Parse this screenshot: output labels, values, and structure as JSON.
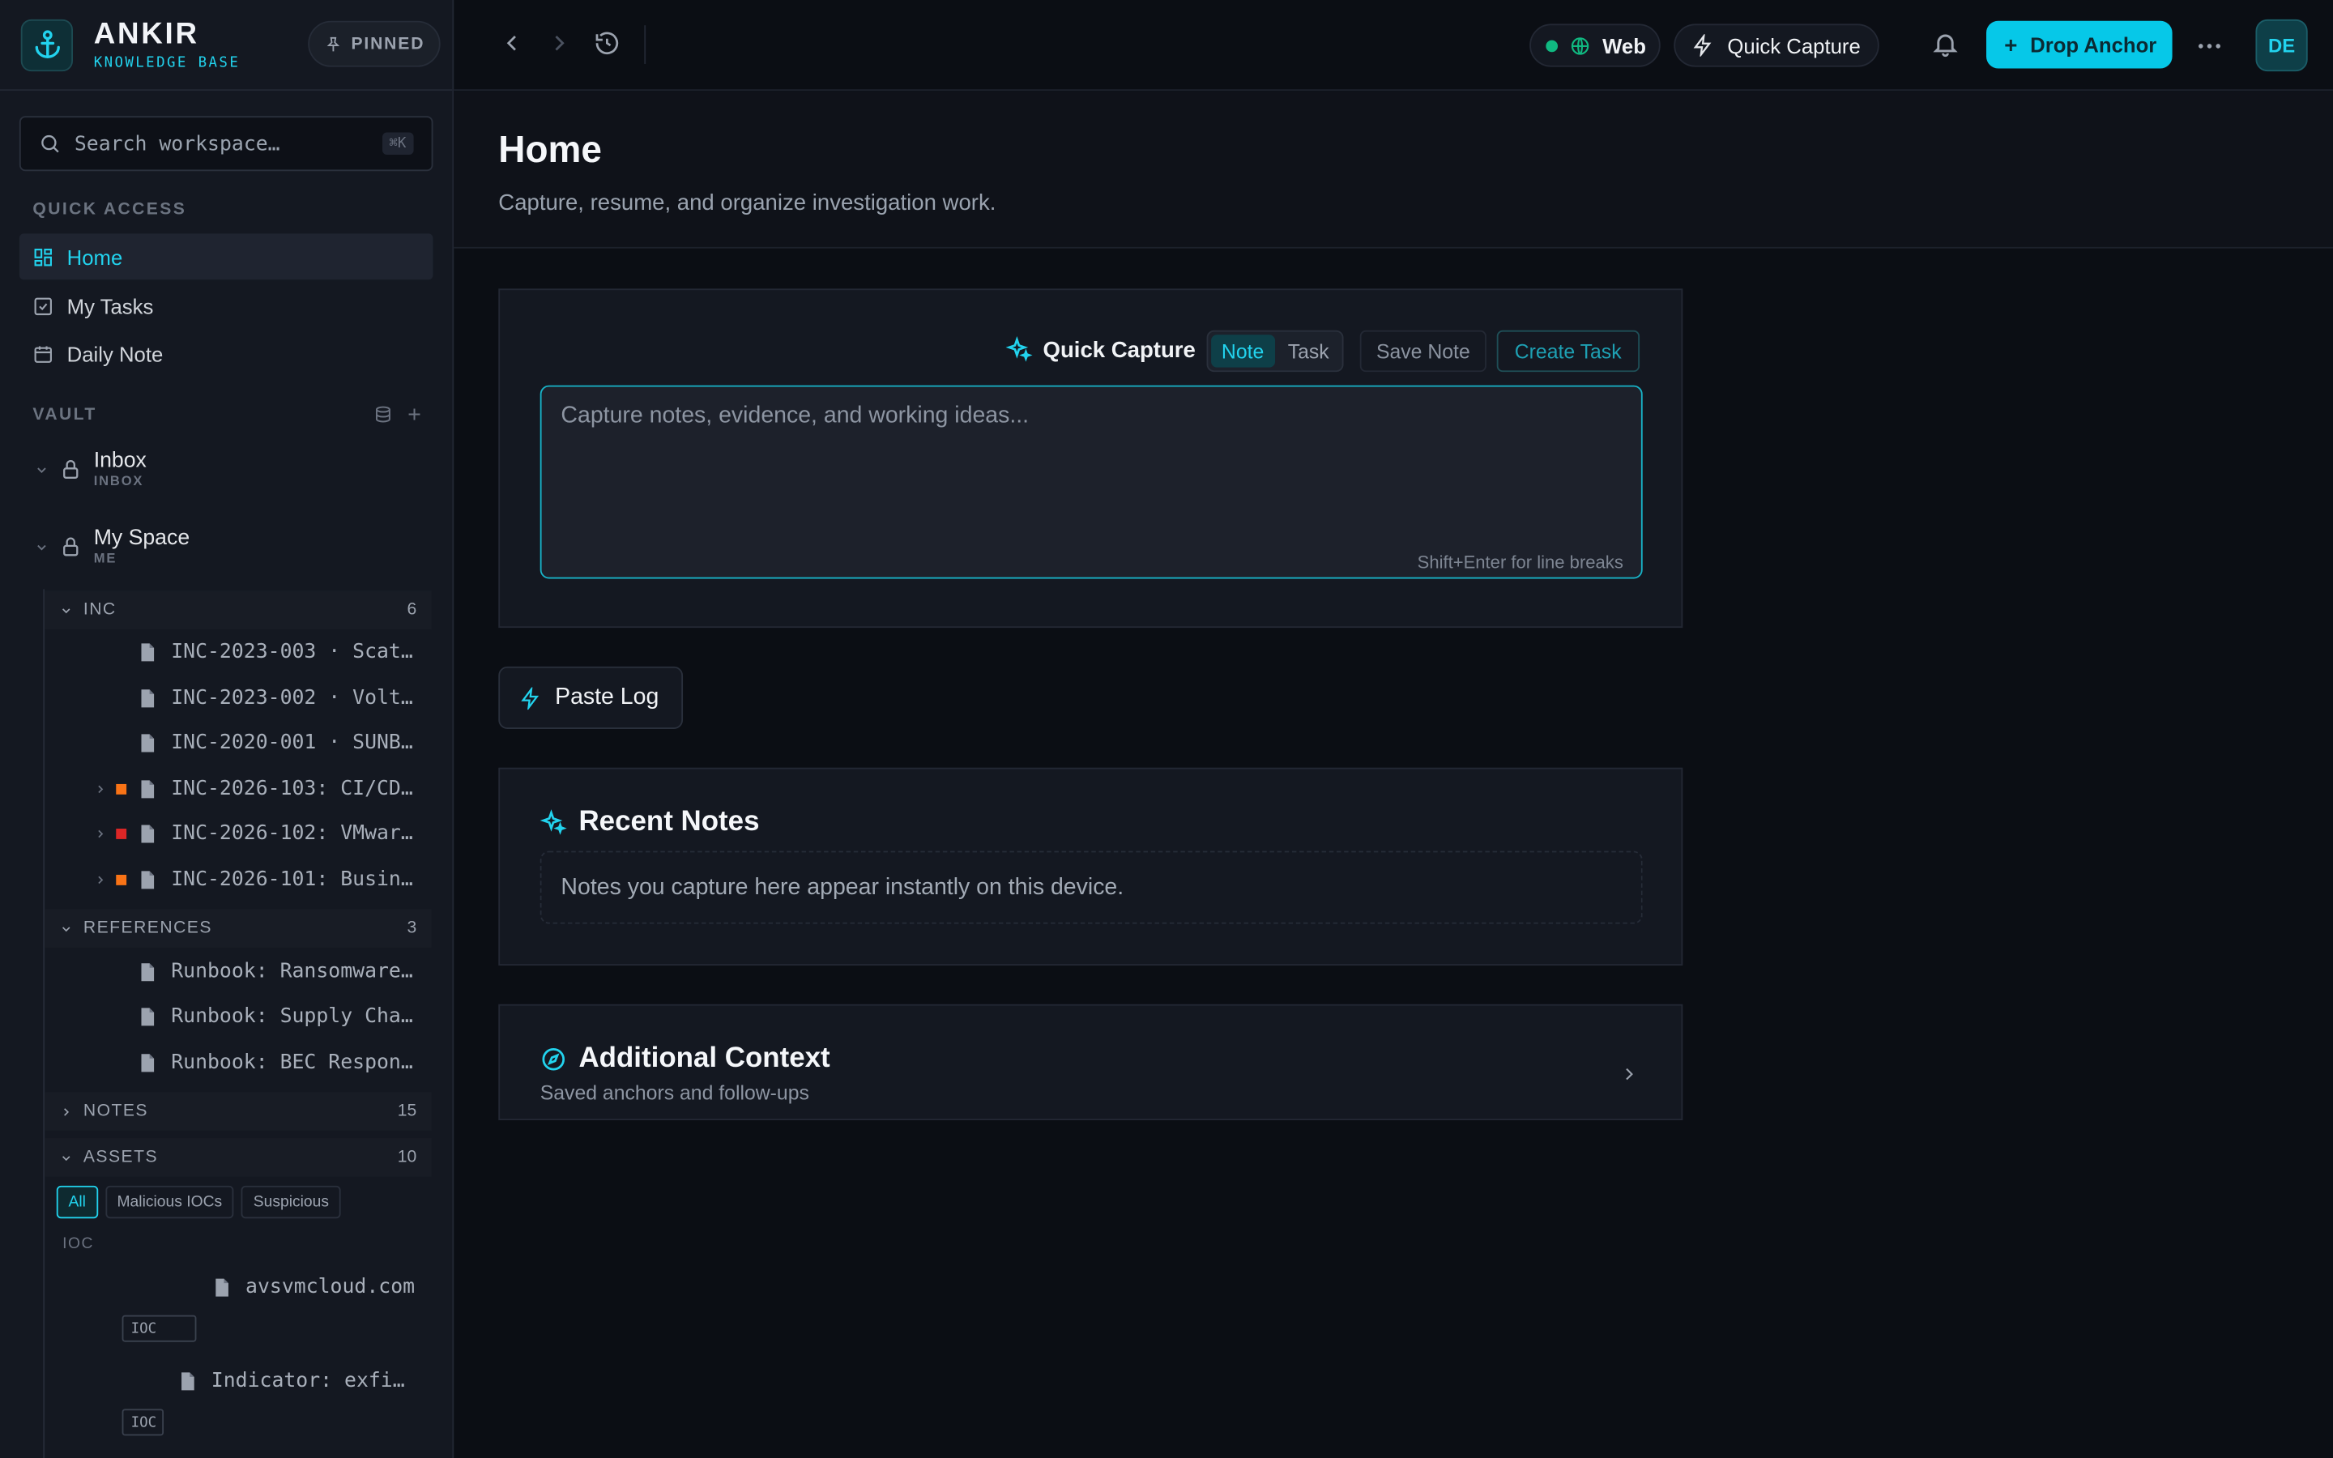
{
  "brand": {
    "name": "ANKIR",
    "subtitle": "KNOWLEDGE BASE",
    "pinned_label": "PINNED"
  },
  "search": {
    "placeholder": "Search workspace…",
    "shortcut": "⌘K"
  },
  "quick_access": {
    "label": "QUICK ACCESS",
    "items": [
      {
        "label": "Home",
        "icon": "grid-icon",
        "active": true
      },
      {
        "label": "My Tasks",
        "icon": "checkbox-icon"
      },
      {
        "label": "Daily Note",
        "icon": "calendar-icon"
      }
    ]
  },
  "vault": {
    "label": "VAULT",
    "spaces": [
      {
        "name": "Inbox",
        "sub": "INBOX"
      },
      {
        "name": "My Space",
        "sub": "ME"
      }
    ],
    "groups": {
      "inc": {
        "label": "INC",
        "count": "6",
        "items": [
          {
            "label": "INC-2023-003 · Scat…"
          },
          {
            "label": "INC-2023-002 · Volt…"
          },
          {
            "label": "INC-2020-001 · SUNB…"
          },
          {
            "label": "INC-2026-103: CI/CD…",
            "severity_color": "#f97316"
          },
          {
            "label": "INC-2026-102: VMwar…",
            "severity_color": "#dc2626"
          },
          {
            "label": "INC-2026-101: Busin…",
            "severity_color": "#f97316"
          }
        ]
      },
      "references": {
        "label": "REFERENCES",
        "count": "3",
        "items": [
          {
            "label": "Runbook: Ransomware…"
          },
          {
            "label": "Runbook: Supply Cha…"
          },
          {
            "label": "Runbook: BEC Respon…"
          }
        ]
      },
      "notes": {
        "label": "NOTES",
        "count": "15"
      },
      "assets": {
        "label": "ASSETS",
        "count": "10",
        "filters": [
          "All",
          "Malicious IOCs",
          "Suspicious"
        ],
        "subgroup": "IOC",
        "items": [
          {
            "label": "avsvmcloud.com",
            "tag": "IOC"
          },
          {
            "label": "Indicator: exfi…",
            "tag": "IOC"
          }
        ]
      }
    }
  },
  "topbar": {
    "status_label": "Web",
    "quick_capture_label": "Quick Capture",
    "primary_button": "Drop Anchor",
    "avatar": "DE"
  },
  "page": {
    "title": "Home",
    "subtitle": "Capture, resume, and organize investigation work."
  },
  "capture": {
    "title": "Quick Capture",
    "modes": [
      "Note",
      "Task"
    ],
    "save_label": "Save Note",
    "create_label": "Create Task",
    "placeholder": "Capture notes, evidence, and working ideas...",
    "hint": "Shift+Enter for line breaks"
  },
  "paste_log": {
    "label": "Paste Log"
  },
  "recent_notes": {
    "title": "Recent Notes",
    "empty": "Notes you capture here appear instantly on this device."
  },
  "additional_context": {
    "title": "Additional Context",
    "subtitle": "Saved anchors and follow-ups"
  },
  "colors": {
    "accent": "#22d3ee",
    "background": "#0b0e14",
    "sidebar": "#141821"
  }
}
